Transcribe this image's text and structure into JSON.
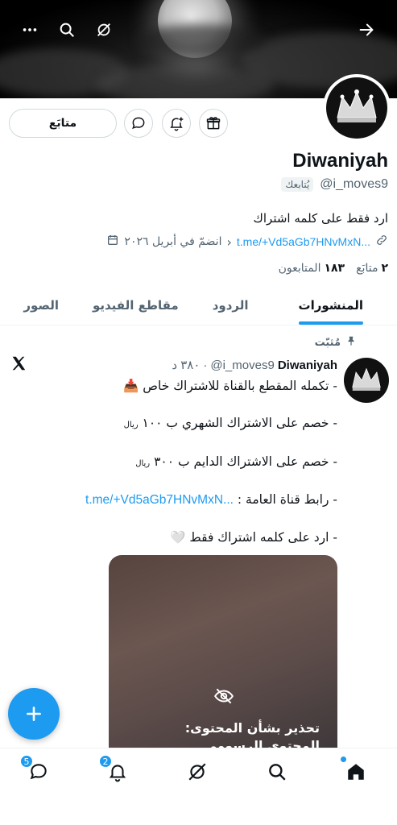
{
  "profile": {
    "display_name": "Diwaniyah",
    "handle": "@i_moves9",
    "follows_you": "يُتابعك",
    "bio": "ارد فقط على كلمه اشتراك",
    "link": "t.me/+Vd5aGb7HNvMxN...",
    "joined": "انضمّ في أبريل ٢٠٢٦",
    "following_count": "٢",
    "following_label": "متابَع",
    "followers_count": "١٨٣",
    "followers_label": "المتابعون"
  },
  "actions": {
    "follow_label": "متابَع"
  },
  "tabs": [
    "المنشورات",
    "الردود",
    "مقاطع الفيديو",
    "الصور"
  ],
  "post": {
    "pinned_label": "مُثبّت",
    "author": "Diwaniyah",
    "handle": "@i_moves9",
    "time": "٣٨٠ د",
    "lines": {
      "l1": "- تكمله المقطع بالقناة للاشتراك خاص",
      "l1_emoji": "📥",
      "l2": "- خصم على الاشتراك الشهري ب ١٠٠",
      "l2_unit": "ريال",
      "l3": "- خصم على الاشتراك الدايم ب ٣٠٠",
      "l3_unit": "ريال",
      "l4_prefix": "- رابط قناة العامة :",
      "l4_link": "t.me/+Vd5aGb7HNvMxN...",
      "l5": "- ارد على كلمه اشتراك فقط",
      "l5_emoji": "🤍"
    },
    "media_warning_title": "تحذير بشأن المحتوى:",
    "media_warning_sub": "المحتوى الرسومي"
  },
  "nav": {
    "messages_badge": "5",
    "notifications_badge": "2"
  },
  "colors": {
    "accent": "#1d9bf0",
    "text": "#0f1419",
    "muted": "#536471"
  }
}
